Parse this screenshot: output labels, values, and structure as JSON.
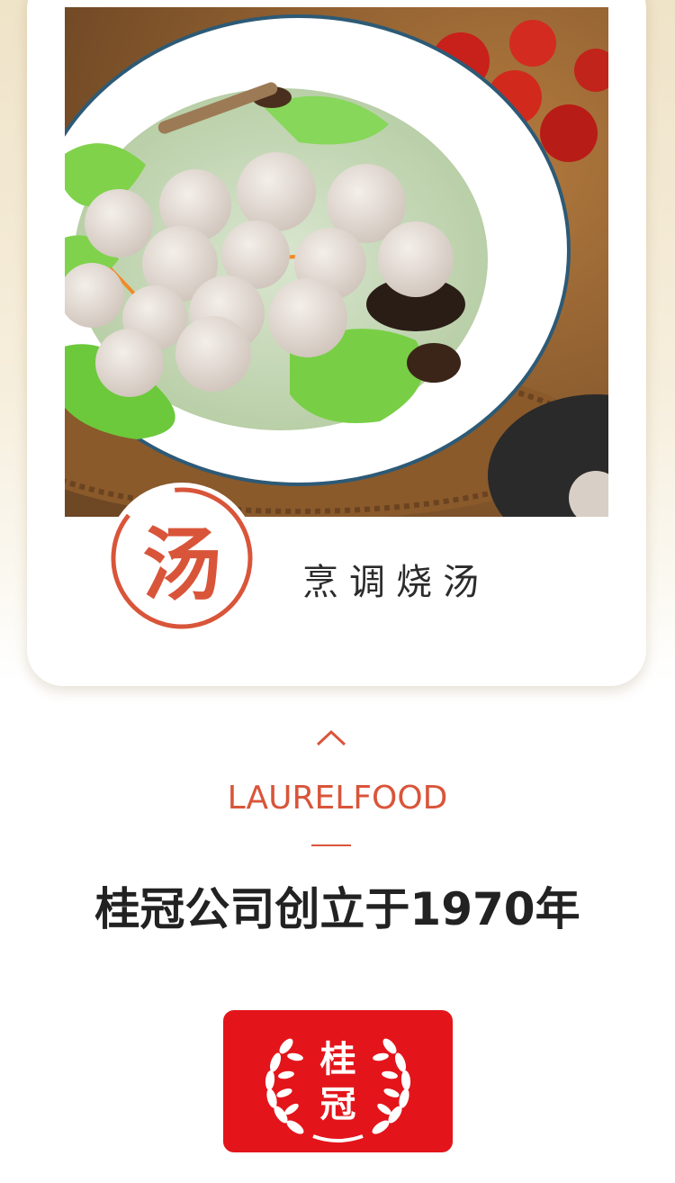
{
  "card": {
    "seal_char": "汤",
    "caption": "烹调烧汤",
    "photo_alt": ""
  },
  "brand": {
    "name_en": "LAURELFOOD",
    "headline": "桂冠公司创立于1970年",
    "logo_line1": "桂",
    "logo_line2": "冠"
  },
  "colors": {
    "accent": "#d9553a",
    "logo_bg": "#e3151b",
    "headline": "#222222"
  },
  "icons": {
    "expand": "chevron-up-icon"
  }
}
